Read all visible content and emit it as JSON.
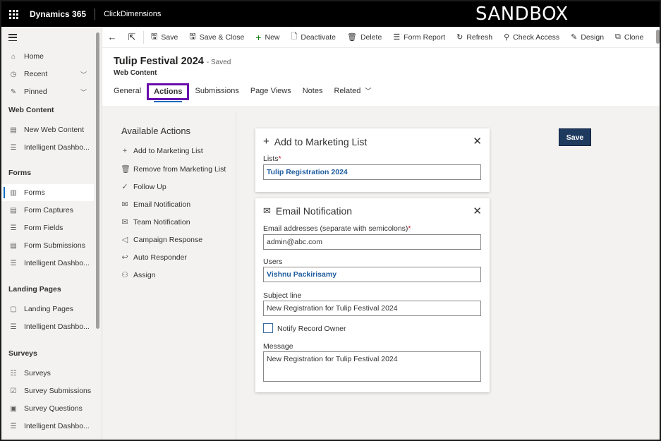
{
  "topbar": {
    "app_name": "Dynamics 365",
    "app_sub": "ClickDimensions",
    "environment_label": "SANDBOX"
  },
  "sidebar": {
    "items": [
      {
        "label": "Home",
        "icon": "home-icon",
        "glyph": "⌂"
      },
      {
        "label": "Recent",
        "icon": "clock-icon",
        "glyph": "◷",
        "chevron": true
      },
      {
        "label": "Pinned",
        "icon": "pin-icon",
        "glyph": "✎",
        "chevron": true
      }
    ],
    "groups": [
      {
        "title": "Web Content",
        "items": [
          {
            "label": "New Web Content",
            "icon": "document-icon",
            "glyph": "▤"
          },
          {
            "label": "Intelligent Dashbo...",
            "icon": "dashboard-icon",
            "glyph": "☰"
          }
        ]
      },
      {
        "title": "Forms",
        "items": [
          {
            "label": "Forms",
            "icon": "form-icon",
            "glyph": "▥",
            "active": true
          },
          {
            "label": "Form Captures",
            "icon": "capture-icon",
            "glyph": "▤"
          },
          {
            "label": "Form Fields",
            "icon": "list-icon",
            "glyph": "☰"
          },
          {
            "label": "Form Submissions",
            "icon": "clipboard-icon",
            "glyph": "▤"
          },
          {
            "label": "Intelligent Dashbo...",
            "icon": "dashboard-icon",
            "glyph": "☰"
          }
        ]
      },
      {
        "title": "Landing Pages",
        "items": [
          {
            "label": "Landing Pages",
            "icon": "page-icon",
            "glyph": "▢"
          },
          {
            "label": "Intelligent Dashbo...",
            "icon": "dashboard-icon",
            "glyph": "☰"
          }
        ]
      },
      {
        "title": "Surveys",
        "items": [
          {
            "label": "Surveys",
            "icon": "survey-icon",
            "glyph": "☷"
          },
          {
            "label": "Survey Submissions",
            "icon": "check-icon",
            "glyph": "☑"
          },
          {
            "label": "Survey Questions",
            "icon": "question-icon",
            "glyph": "▣"
          },
          {
            "label": "Intelligent Dashbo...",
            "icon": "dashboard-icon",
            "glyph": "☰"
          }
        ]
      }
    ]
  },
  "commandbar": {
    "commands": [
      {
        "label": "Save",
        "icon": "save-icon",
        "glyph": "🖫"
      },
      {
        "label": "Save & Close",
        "icon": "save-close-icon",
        "glyph": "🖫"
      },
      {
        "label": "New",
        "icon": "plus-icon",
        "glyph": "+"
      },
      {
        "label": "Deactivate",
        "icon": "deactivate-icon",
        "glyph": "🗋"
      },
      {
        "label": "Delete",
        "icon": "trash-icon",
        "glyph": "🗑"
      },
      {
        "label": "Form Report",
        "icon": "report-icon",
        "glyph": "☰"
      },
      {
        "label": "Refresh",
        "icon": "refresh-icon",
        "glyph": "↻"
      },
      {
        "label": "Check Access",
        "icon": "key-icon",
        "glyph": "⚲"
      },
      {
        "label": "Design",
        "icon": "design-icon",
        "glyph": "✎"
      },
      {
        "label": "Clone",
        "icon": "clone-icon",
        "glyph": "⧉"
      }
    ]
  },
  "header": {
    "title": "Tulip Festival 2024",
    "saved_status": "- Saved",
    "entity": "Web Content",
    "tabs": [
      "General",
      "Actions",
      "Submissions",
      "Page Views",
      "Notes",
      "Related"
    ],
    "active_tab": "Actions"
  },
  "actions_panel": {
    "title": "Available Actions",
    "items": [
      {
        "label": "Add to Marketing List",
        "icon": "plus-icon",
        "glyph": "+"
      },
      {
        "label": "Remove from Marketing List",
        "icon": "trash-icon",
        "glyph": "🗑"
      },
      {
        "label": "Follow Up",
        "icon": "check-circle-icon",
        "glyph": "✓"
      },
      {
        "label": "Email Notification",
        "icon": "mail-icon",
        "glyph": "✉"
      },
      {
        "label": "Team Notification",
        "icon": "mail-icon",
        "glyph": "✉"
      },
      {
        "label": "Campaign Response",
        "icon": "megaphone-icon",
        "glyph": "◁"
      },
      {
        "label": "Auto Responder",
        "icon": "reply-icon",
        "glyph": "↩"
      },
      {
        "label": "Assign",
        "icon": "people-icon",
        "glyph": "⚇"
      }
    ]
  },
  "marketing_card": {
    "title": "Add to Marketing List",
    "lists_label": "Lists",
    "lists_value": "Tulip Registration 2024"
  },
  "email_card": {
    "title": "Email Notification",
    "email_label": "Email addresses (separate with semicolons)",
    "email_value": "admin@abc.com",
    "users_label": "Users",
    "users_value": "Vishnu Packirisamy",
    "subject_label": "Subject line",
    "subject_value": "New Registration for Tulip Festival 2024",
    "notify_label": "Notify Record Owner",
    "message_label": "Message",
    "message_value": "New Registration for Tulip Festival 2024"
  },
  "save_button": "Save",
  "colors": {
    "accent": "#6a0dad",
    "primary_button": "#1f3a5f",
    "link": "#1d5b9f",
    "topbar": "#000000"
  }
}
